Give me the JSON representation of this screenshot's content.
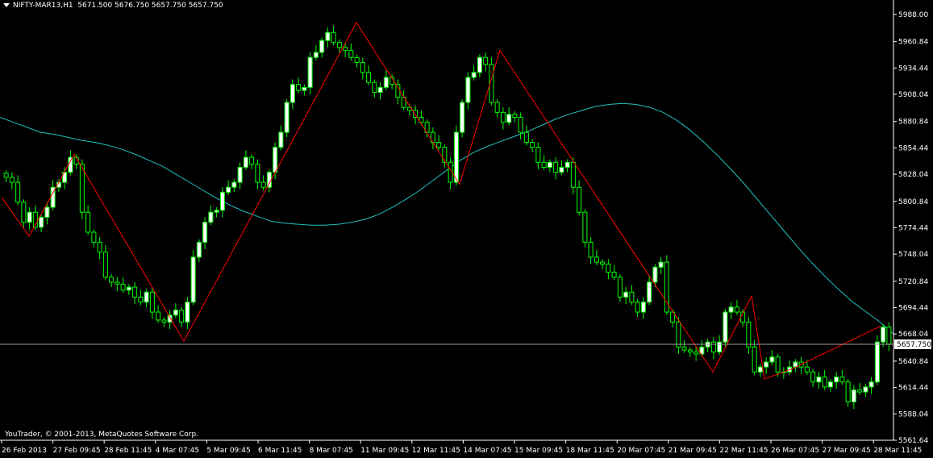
{
  "header": {
    "symbol": "NIFTY-MAR13,H1",
    "ohlc": "5671.500 5676.750 5657.750 5657.750"
  },
  "copyright": "YouTrader, © 2001-2013, MetaQuotes Software Corp.",
  "colors": {
    "background": "#000000",
    "axis": "#ffffff",
    "candle_bull": "#ffffff",
    "candle_bear": "#000000",
    "candle_outline": "#00ff00",
    "zigzag": "#ff0000",
    "moving_average": "#20c0c0",
    "price_line": "#a0a0a0"
  },
  "chart_data": {
    "type": "candlestick",
    "symbol": "NIFTY-MAR13",
    "timeframe": "H1",
    "ylim": [
      5561.64,
      5988.0
    ],
    "y_ticks": [
      "5988.00",
      "5960.84",
      "5934.44",
      "5908.04",
      "5880.84",
      "5854.44",
      "5828.04",
      "5800.84",
      "5774.44",
      "5748.04",
      "5720.84",
      "5694.44",
      "5668.04",
      "5640.84",
      "5614.44",
      "5588.04",
      "5561.64"
    ],
    "x_ticks": [
      "26 Feb 2013",
      "27 Feb 09:45",
      "28 Feb 11:45",
      "4 Mar 07:45",
      "5 Mar 09:45",
      "6 Mar 11:45",
      "8 Mar 07:45",
      "11 Mar 09:45",
      "12 Mar 11:45",
      "14 Mar 07:45",
      "15 Mar 09:45",
      "18 Mar 11:45",
      "20 Mar 07:45",
      "21 Mar 09:45",
      "22 Mar 11:45",
      "26 Mar 07:45",
      "27 Mar 09:45",
      "28 Mar 11:45"
    ],
    "current_price": "5657.750",
    "closes": [
      5825,
      5820,
      5800,
      5780,
      5790,
      5775,
      5785,
      5795,
      5815,
      5820,
      5830,
      5845,
      5838,
      5790,
      5770,
      5760,
      5750,
      5725,
      5720,
      5718,
      5712,
      5715,
      5705,
      5700,
      5710,
      5690,
      5682,
      5680,
      5687,
      5692,
      5680,
      5700,
      5745,
      5760,
      5780,
      5790,
      5792,
      5810,
      5815,
      5820,
      5835,
      5845,
      5838,
      5820,
      5815,
      5830,
      5855,
      5870,
      5900,
      5918,
      5912,
      5915,
      5945,
      5950,
      5962,
      5970,
      5960,
      5955,
      5952,
      5945,
      5940,
      5930,
      5920,
      5910,
      5915,
      5925,
      5918,
      5905,
      5895,
      5892,
      5885,
      5880,
      5870,
      5860,
      5855,
      5840,
      5820,
      5870,
      5900,
      5925,
      5930,
      5945,
      5938,
      5900,
      5890,
      5880,
      5888,
      5885,
      5870,
      5860,
      5855,
      5840,
      5835,
      5840,
      5830,
      5835,
      5840,
      5815,
      5790,
      5760,
      5745,
      5740,
      5738,
      5730,
      5725,
      5705,
      5710,
      5700,
      5690,
      5700,
      5720,
      5735,
      5740,
      5690,
      5680,
      5655,
      5652,
      5650,
      5648,
      5655,
      5660,
      5650,
      5660,
      5690,
      5695,
      5690,
      5680,
      5655,
      5630,
      5635,
      5640,
      5645,
      5630,
      5630,
      5635,
      5640,
      5635,
      5630,
      5620,
      5625,
      5615,
      5620,
      5625,
      5620,
      5600,
      5612,
      5610,
      5615,
      5620,
      5660,
      5675,
      5658
    ],
    "moving_average": [
      5885,
      5880,
      5875,
      5870,
      5868,
      5865,
      5862,
      5860,
      5857,
      5853,
      5848,
      5842,
      5836,
      5828,
      5820,
      5812,
      5804,
      5797,
      5791,
      5786,
      5781,
      5779,
      5778,
      5777,
      5777,
      5778,
      5780,
      5783,
      5788,
      5795,
      5803,
      5812,
      5822,
      5832,
      5842,
      5850,
      5856,
      5861,
      5866,
      5871,
      5877,
      5883,
      5888,
      5892,
      5896,
      5898,
      5899,
      5898,
      5895,
      5890,
      5882,
      5872,
      5860,
      5847,
      5833,
      5818,
      5802,
      5786,
      5770,
      5754,
      5739,
      5725,
      5712,
      5700,
      5690,
      5680,
      5668
    ],
    "zigzag": [
      {
        "x": "26 Feb 2013",
        "y": 5805
      },
      {
        "x": "27 Feb",
        "y": 5766
      },
      {
        "x": "27 Feb 09:45",
        "y": 5848
      },
      {
        "x": "4 Mar 07:45",
        "y": 5661
      },
      {
        "x": "8 Mar 07:45",
        "y": 5980
      },
      {
        "x": "12 Mar 11:45",
        "y": 5818
      },
      {
        "x": "14 Mar 07:45",
        "y": 5952
      },
      {
        "x": "21 Mar 09:45",
        "y": 5630
      },
      {
        "x": "22 Mar 11:45",
        "y": 5706
      },
      {
        "x": "22 Mar",
        "y": 5623
      },
      {
        "x": "26 Mar 07:45",
        "y": 5633
      },
      {
        "x": "28 Mar 11:45",
        "y": 5676
      }
    ]
  }
}
